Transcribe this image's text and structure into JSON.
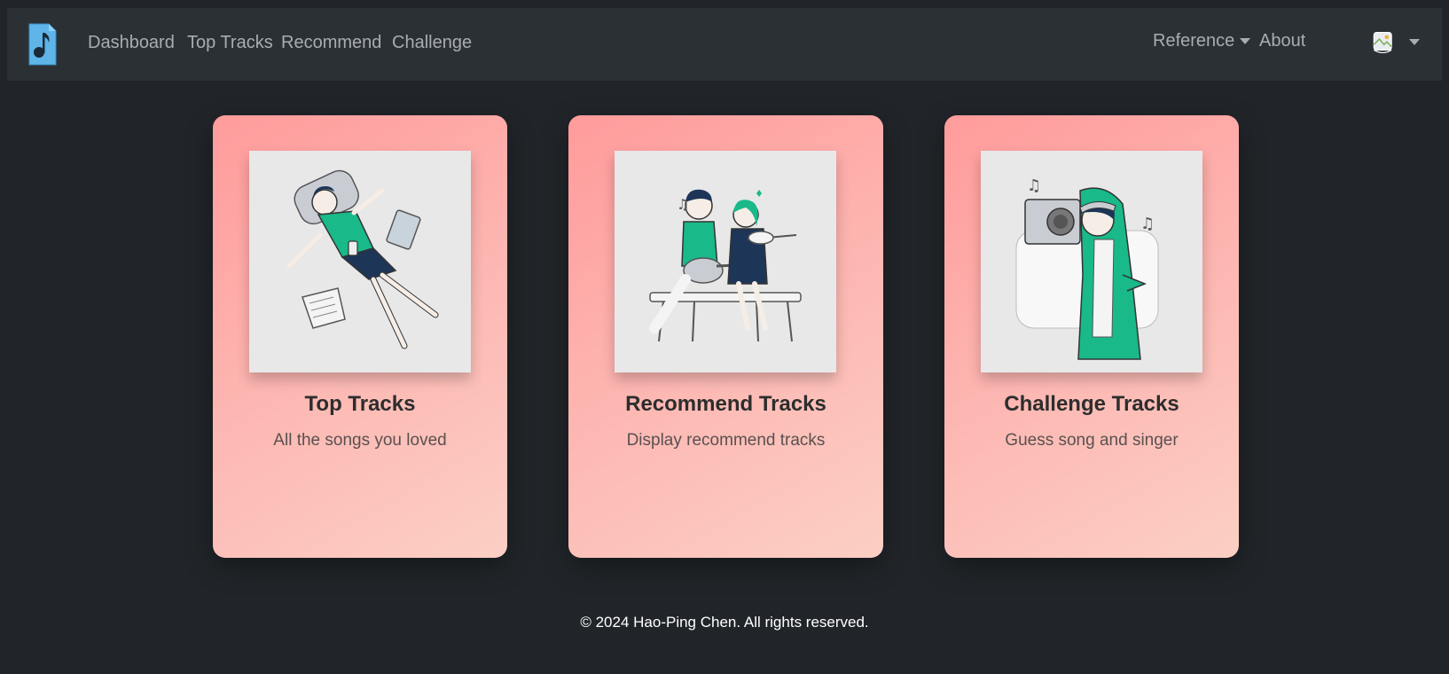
{
  "nav": {
    "brand_icon": "music-note-file-icon",
    "links": [
      "Dashboard",
      "Top Tracks",
      "Recommend",
      "Challenge"
    ],
    "reference_label": "Reference",
    "about_label": "About",
    "avatar_icon": "user-avatar-broken-image"
  },
  "cards": [
    {
      "title": "Top Tracks",
      "text": "All the songs you loved",
      "illustration": "person-lying-down-with-music-player"
    },
    {
      "title": "Recommend Tracks",
      "text": "Display recommend tracks",
      "illustration": "couple-playing-guitar-and-violin"
    },
    {
      "title": "Challenge Tracks",
      "text": "Guess song and singer",
      "illustration": "person-with-boombox"
    }
  ],
  "footer": {
    "text": "© 2024 Hao-Ping Chen. All rights reserved."
  },
  "colors": {
    "page_bg": "#212529",
    "navbar_bg": "#2b3035",
    "nav_text": "#a8adb2",
    "brand_accent": "#5fb4e8",
    "card_gradient_start": "#ff9b9b",
    "card_gradient_end": "#fbcfc4",
    "illustration_green": "#19b98a",
    "illustration_navy": "#1d3557"
  }
}
